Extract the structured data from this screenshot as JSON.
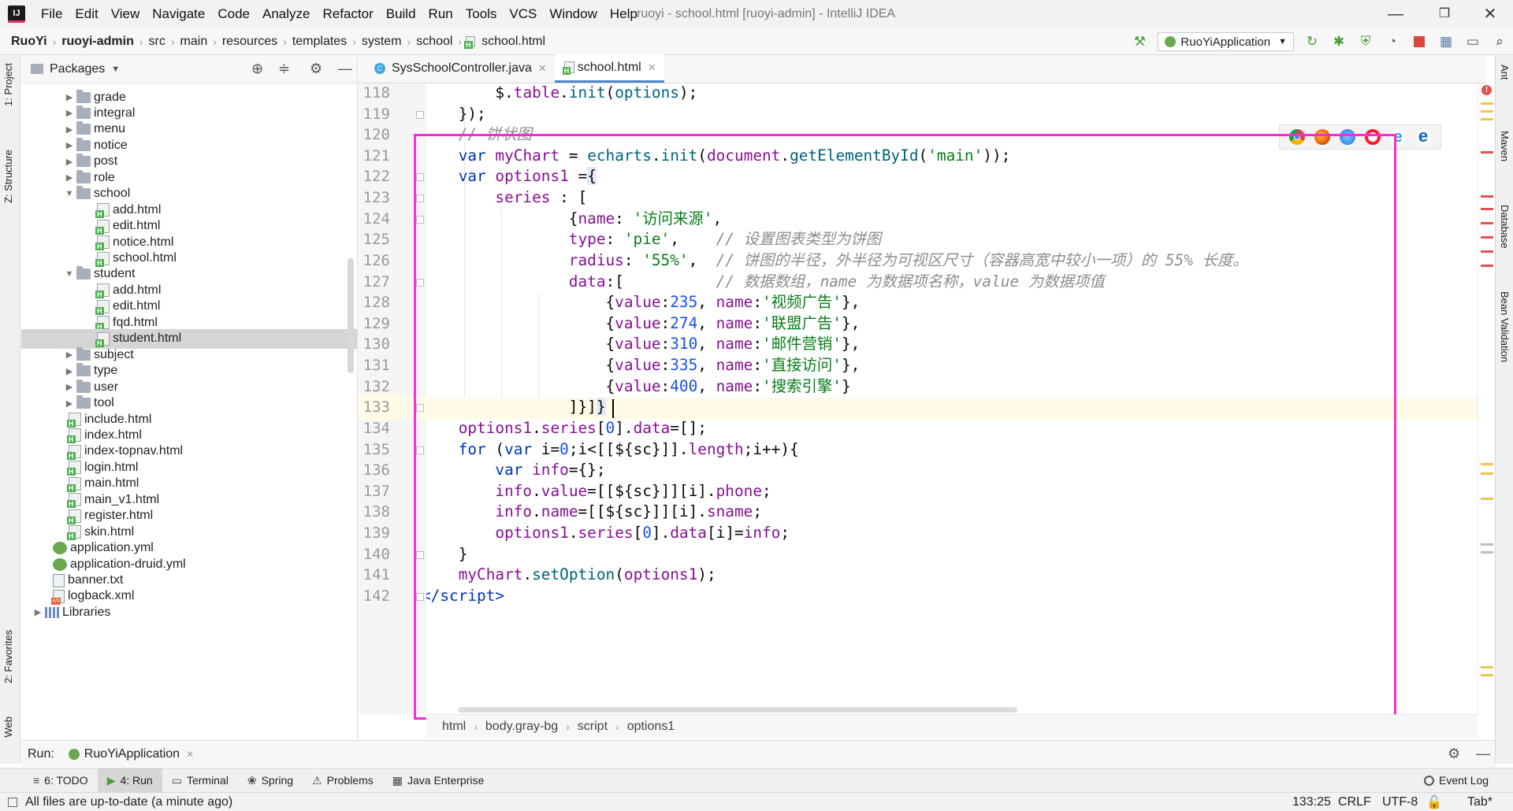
{
  "menu": [
    "File",
    "Edit",
    "View",
    "Navigate",
    "Code",
    "Analyze",
    "Refactor",
    "Build",
    "Run",
    "Tools",
    "VCS",
    "Window",
    "Help"
  ],
  "window_title": "ruoyi - school.html [ruoyi-admin] - IntelliJ IDEA",
  "breadcrumb": [
    "RuoYi",
    "ruoyi-admin",
    "src",
    "main",
    "resources",
    "templates",
    "system",
    "school",
    "school.html"
  ],
  "run_config": "RuoYiApplication",
  "left_tabs": {
    "project": "1: Project",
    "structure": "Z: Structure",
    "favorites": "2: Favorites",
    "web": "Web"
  },
  "right_tabs": {
    "ant": "Ant",
    "maven": "Maven",
    "database": "Database",
    "bean": "Bean Validation"
  },
  "project_panel": {
    "title": "Packages"
  },
  "tree": [
    {
      "label": "grade",
      "type": "folder",
      "depth": 2,
      "arrow": "▶"
    },
    {
      "label": "integral",
      "type": "folder",
      "depth": 2,
      "arrow": "▶"
    },
    {
      "label": "menu",
      "type": "folder",
      "depth": 2,
      "arrow": "▶"
    },
    {
      "label": "notice",
      "type": "folder",
      "depth": 2,
      "arrow": "▶"
    },
    {
      "label": "post",
      "type": "folder",
      "depth": 2,
      "arrow": "▶"
    },
    {
      "label": "role",
      "type": "folder",
      "depth": 2,
      "arrow": "▶"
    },
    {
      "label": "school",
      "type": "folder",
      "depth": 2,
      "arrow": "▼"
    },
    {
      "label": "add.html",
      "type": "html",
      "depth": 3,
      "arrow": ""
    },
    {
      "label": "edit.html",
      "type": "html",
      "depth": 3,
      "arrow": ""
    },
    {
      "label": "notice.html",
      "type": "html",
      "depth": 3,
      "arrow": ""
    },
    {
      "label": "school.html",
      "type": "html",
      "depth": 3,
      "arrow": ""
    },
    {
      "label": "student",
      "type": "folder",
      "depth": 2,
      "arrow": "▼"
    },
    {
      "label": "add.html",
      "type": "html",
      "depth": 3,
      "arrow": ""
    },
    {
      "label": "edit.html",
      "type": "html",
      "depth": 3,
      "arrow": ""
    },
    {
      "label": "fqd.html",
      "type": "html",
      "depth": 3,
      "arrow": ""
    },
    {
      "label": "student.html",
      "type": "html",
      "depth": 3,
      "arrow": "",
      "selected": true
    },
    {
      "label": "subject",
      "type": "folder",
      "depth": 2,
      "arrow": "▶"
    },
    {
      "label": "type",
      "type": "folder",
      "depth": 2,
      "arrow": "▶"
    },
    {
      "label": "user",
      "type": "folder",
      "depth": 2,
      "arrow": "▶"
    },
    {
      "label": "tool",
      "type": "folder",
      "depth": 1,
      "arrow": "▶"
    },
    {
      "label": "include.html",
      "type": "html",
      "depth": 1,
      "arrow": ""
    },
    {
      "label": "index.html",
      "type": "html",
      "depth": 1,
      "arrow": ""
    },
    {
      "label": "index-topnav.html",
      "type": "html",
      "depth": 1,
      "arrow": ""
    },
    {
      "label": "login.html",
      "type": "html",
      "depth": 1,
      "arrow": ""
    },
    {
      "label": "main.html",
      "type": "html",
      "depth": 1,
      "arrow": ""
    },
    {
      "label": "main_v1.html",
      "type": "html",
      "depth": 1,
      "arrow": ""
    },
    {
      "label": "register.html",
      "type": "html",
      "depth": 1,
      "arrow": ""
    },
    {
      "label": "skin.html",
      "type": "html",
      "depth": 1,
      "arrow": ""
    },
    {
      "label": "application.yml",
      "type": "yml",
      "depth": 0,
      "arrow": ""
    },
    {
      "label": "application-druid.yml",
      "type": "yml",
      "depth": 0,
      "arrow": ""
    },
    {
      "label": "banner.txt",
      "type": "txt",
      "depth": 0,
      "arrow": ""
    },
    {
      "label": "logback.xml",
      "type": "xml",
      "depth": 0,
      "arrow": ""
    },
    {
      "label": "Libraries",
      "type": "lib",
      "depth": -1,
      "arrow": "▶"
    }
  ],
  "editor_tabs": [
    {
      "label": "SysSchoolController.java",
      "active": false
    },
    {
      "label": "school.html",
      "active": true
    }
  ],
  "line_numbers": [
    "118",
    "119",
    "120",
    "121",
    "122",
    "123",
    "124",
    "125",
    "126",
    "127",
    "128",
    "129",
    "130",
    "131",
    "132",
    "133",
    "134",
    "135",
    "136",
    "137",
    "138",
    "139",
    "140",
    "141",
    "142"
  ],
  "code_lines": [
    [
      [
        "        ",
        ""
      ],
      [
        "$",
        ""
      ],
      [
        ".",
        ""
      ],
      [
        "table",
        "prop"
      ],
      [
        ".",
        ""
      ],
      [
        "init",
        "fn"
      ],
      [
        "(",
        ""
      ],
      [
        "options",
        "fn"
      ],
      [
        ");",
        ""
      ]
    ],
    [
      [
        "    });",
        ""
      ]
    ],
    [
      [
        "    ",
        ""
      ],
      [
        "// 饼状图",
        "cm"
      ]
    ],
    [
      [
        "    ",
        ""
      ],
      [
        "var",
        "kw"
      ],
      [
        " ",
        ""
      ],
      [
        "myChart",
        "prop"
      ],
      [
        " = ",
        ""
      ],
      [
        "echarts",
        "fn"
      ],
      [
        ".",
        ""
      ],
      [
        "init",
        "fn"
      ],
      [
        "(",
        ""
      ],
      [
        "document",
        "prop"
      ],
      [
        ".",
        ""
      ],
      [
        "getElementById",
        "fn"
      ],
      [
        "(",
        ""
      ],
      [
        "'main'",
        "str"
      ],
      [
        "));",
        ""
      ]
    ],
    [
      [
        "    ",
        ""
      ],
      [
        "var",
        "kw"
      ],
      [
        " ",
        ""
      ],
      [
        "options1",
        "prop"
      ],
      [
        " =",
        ""
      ],
      [
        "{",
        "ib"
      ]
    ],
    [
      [
        "        ",
        ""
      ],
      [
        "series",
        "prop"
      ],
      [
        " : [",
        ""
      ]
    ],
    [
      [
        "                {",
        ""
      ],
      [
        "name",
        "prop"
      ],
      [
        ": ",
        ""
      ],
      [
        "'访问来源'",
        "str"
      ],
      [
        ",",
        ""
      ]
    ],
    [
      [
        "                ",
        ""
      ],
      [
        "type",
        "prop"
      ],
      [
        ": ",
        ""
      ],
      [
        "'pie'",
        "str"
      ],
      [
        ",    ",
        ""
      ],
      [
        "// 设置图表类型为饼图",
        "cm"
      ]
    ],
    [
      [
        "                ",
        ""
      ],
      [
        "radius",
        "prop"
      ],
      [
        ": ",
        ""
      ],
      [
        "'55%'",
        "str"
      ],
      [
        ",  ",
        ""
      ],
      [
        "// 饼图的半径，外半径为可视区尺寸（容器高宽中较小一项）的 55% 长度。",
        "cm"
      ]
    ],
    [
      [
        "                ",
        ""
      ],
      [
        "data",
        "prop"
      ],
      [
        ":[          ",
        ""
      ],
      [
        "// 数据数组，name 为数据项名称，value 为数据项值",
        "cm"
      ]
    ],
    [
      [
        "                    {",
        ""
      ],
      [
        "value",
        "prop"
      ],
      [
        ":",
        ""
      ],
      [
        "235",
        "num"
      ],
      [
        ", ",
        ""
      ],
      [
        "name",
        "prop"
      ],
      [
        ":",
        ""
      ],
      [
        "'视频广告'",
        "str"
      ],
      [
        "},",
        ""
      ]
    ],
    [
      [
        "                    {",
        ""
      ],
      [
        "value",
        "prop"
      ],
      [
        ":",
        ""
      ],
      [
        "274",
        "num"
      ],
      [
        ", ",
        ""
      ],
      [
        "name",
        "prop"
      ],
      [
        ":",
        ""
      ],
      [
        "'联盟广告'",
        "str"
      ],
      [
        "},",
        ""
      ]
    ],
    [
      [
        "                    {",
        ""
      ],
      [
        "value",
        "prop"
      ],
      [
        ":",
        ""
      ],
      [
        "310",
        "num"
      ],
      [
        ", ",
        ""
      ],
      [
        "name",
        "prop"
      ],
      [
        ":",
        ""
      ],
      [
        "'邮件营销'",
        "str"
      ],
      [
        "},",
        ""
      ]
    ],
    [
      [
        "                    {",
        ""
      ],
      [
        "value",
        "prop"
      ],
      [
        ":",
        ""
      ],
      [
        "335",
        "num"
      ],
      [
        ", ",
        ""
      ],
      [
        "name",
        "prop"
      ],
      [
        ":",
        ""
      ],
      [
        "'直接访问'",
        "str"
      ],
      [
        "},",
        ""
      ]
    ],
    [
      [
        "                    {",
        ""
      ],
      [
        "value",
        "prop"
      ],
      [
        ":",
        ""
      ],
      [
        "400",
        "num"
      ],
      [
        ", ",
        ""
      ],
      [
        "name",
        "prop"
      ],
      [
        ":",
        ""
      ],
      [
        "'搜索引擎'",
        "str"
      ],
      [
        "}",
        ""
      ]
    ],
    [
      [
        "                ]}]",
        ""
      ],
      [
        "}",
        "ib"
      ]
    ],
    [
      [
        "    ",
        ""
      ],
      [
        "options1",
        "prop"
      ],
      [
        ".",
        ""
      ],
      [
        "series",
        "prop"
      ],
      [
        "[",
        ""
      ],
      [
        "0",
        "num"
      ],
      [
        "].",
        ""
      ],
      [
        "data",
        "prop"
      ],
      [
        "=[];",
        ""
      ]
    ],
    [
      [
        "    ",
        ""
      ],
      [
        "for",
        "kw"
      ],
      [
        " (",
        ""
      ],
      [
        "var",
        "kw"
      ],
      [
        " i=",
        ""
      ],
      [
        "0",
        "num"
      ],
      [
        ";i<[[${sc}]].",
        ""
      ],
      [
        "length",
        "prop"
      ],
      [
        ";i++){",
        ""
      ]
    ],
    [
      [
        "        ",
        ""
      ],
      [
        "var",
        "kw"
      ],
      [
        " ",
        ""
      ],
      [
        "info",
        "prop"
      ],
      [
        "={};",
        ""
      ]
    ],
    [
      [
        "        ",
        ""
      ],
      [
        "info",
        "prop"
      ],
      [
        ".",
        ""
      ],
      [
        "value",
        "prop"
      ],
      [
        "=[[${sc}]][i].",
        ""
      ],
      [
        "phone",
        "prop"
      ],
      [
        ";",
        ""
      ]
    ],
    [
      [
        "        ",
        ""
      ],
      [
        "info",
        "prop"
      ],
      [
        ".",
        ""
      ],
      [
        "name",
        "prop"
      ],
      [
        "=[[${sc}]][i].",
        ""
      ],
      [
        "sname",
        "prop"
      ],
      [
        ";",
        ""
      ]
    ],
    [
      [
        "        ",
        ""
      ],
      [
        "options1",
        "prop"
      ],
      [
        ".",
        ""
      ],
      [
        "series",
        "prop"
      ],
      [
        "[",
        ""
      ],
      [
        "0",
        "num"
      ],
      [
        "].",
        ""
      ],
      [
        "data",
        "prop"
      ],
      [
        "[i]=",
        ""
      ],
      [
        "info",
        "prop"
      ],
      [
        ";",
        ""
      ]
    ],
    [
      [
        "    }",
        ""
      ]
    ],
    [
      [
        "    ",
        ""
      ],
      [
        "myChart",
        "prop"
      ],
      [
        ".",
        ""
      ],
      [
        "setOption",
        "fn"
      ],
      [
        "(",
        ""
      ],
      [
        "options1",
        "prop"
      ],
      [
        ");",
        ""
      ]
    ],
    [
      [
        "</",
        "tag"
      ],
      [
        "script",
        "tag"
      ],
      [
        ">",
        "tag"
      ]
    ]
  ],
  "current_line_index": 15,
  "editor_breadcrumb": [
    "html",
    "body.gray-bg",
    "script",
    "options1"
  ],
  "run_panel": {
    "label": "Run:",
    "config": "RuoYiApplication"
  },
  "bottom_tabs": [
    {
      "label": "6: TODO",
      "active": false
    },
    {
      "label": "4: Run",
      "active": true
    },
    {
      "label": "Terminal",
      "active": false
    },
    {
      "label": "Spring",
      "active": false
    },
    {
      "label": "Problems",
      "active": false
    },
    {
      "label": "Java Enterprise",
      "active": false
    }
  ],
  "event_log": "Event Log",
  "status": {
    "message": "All files are up-to-date (a minute ago)",
    "position": "133:25",
    "line_sep": "CRLF",
    "encoding": "UTF-8",
    "indent": "Tab*"
  },
  "colors": {
    "highlight_box": "#ff2bd6",
    "keyword": "#0033b3",
    "string": "#067d17",
    "number": "#1750eb",
    "comment": "#8c8c8c",
    "property": "#871094"
  }
}
